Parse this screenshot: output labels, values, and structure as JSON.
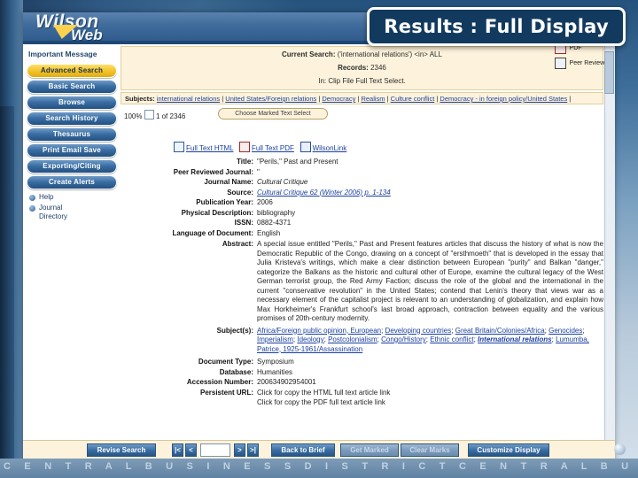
{
  "slide": {
    "overlay_title": "Results : Full Display",
    "footer_band_text": "C E N T R A L   B U S I N E S S   D I S T R I C T   C E N T R A L   B U S I N E S S   D I S T R I C T   C E N T R A"
  },
  "window": {
    "logo_top": "Wilson",
    "logo_bottom": "Web",
    "header_title": "Results: Full Display"
  },
  "sidebar": {
    "message": "Important Message",
    "items": [
      {
        "label": "Advanced Search",
        "selected": true
      },
      {
        "label": "Basic Search",
        "selected": false
      },
      {
        "label": "Browse",
        "selected": false
      },
      {
        "label": "Search History",
        "selected": false
      },
      {
        "label": "Thesaurus",
        "selected": false
      },
      {
        "label": "Print Email Save",
        "selected": false
      },
      {
        "label": "Exporting/Citing",
        "selected": false
      },
      {
        "label": "Create Alerts",
        "selected": false
      }
    ],
    "links": [
      "Help",
      "Journal",
      "Directory"
    ]
  },
  "legend": [
    {
      "icon": "pdf-icon",
      "label": "PDF"
    },
    {
      "icon": "peer-reviewed-icon",
      "label": "Peer Reviewed"
    }
  ],
  "search_summary": {
    "current_search_label": "Current Search:",
    "current_search_value": "('international relations') <in> ALL",
    "records_label": "Records:",
    "records_value": "2346",
    "limits": "In: Clip File Full Text Select."
  },
  "subject_bar": {
    "label": "Subjects:",
    "links": [
      "international relations",
      "United States/Foreign relations",
      "Democracy",
      "Realism",
      "Culture conflict",
      "Democracy - in foreign policy/United States"
    ]
  },
  "toolbar": {
    "zoom": "100%",
    "record_position": "1 of 2346",
    "select_button": "Choose Marked Text Select"
  },
  "record": {
    "links": [
      {
        "icon": "html-doc-icon",
        "label": "Full Text HTML"
      },
      {
        "icon": "pdf-doc-icon",
        "label": "Full Text PDF"
      },
      {
        "icon": "wilsonlink-icon",
        "label": "WilsonLink"
      }
    ],
    "fields": [
      {
        "label": "Title:",
        "value": "\"Perils,\" Past and Present",
        "style": "plain"
      },
      {
        "label": "Peer Reviewed Journal:",
        "value": "\"",
        "style": "plain"
      },
      {
        "label": "Journal Name:",
        "value": "Cultural Critique",
        "style": "italic"
      },
      {
        "label": "Source:",
        "value": "Cultural Critique  62 (Winter 2006) p. 1-134",
        "style": "link-italic"
      },
      {
        "label": "Publication Year:",
        "value": "2006",
        "style": "plain"
      },
      {
        "label": "Physical Description:",
        "value": "bibliography",
        "style": "plain"
      },
      {
        "label": "ISSN:",
        "value": "0882-4371",
        "style": "plain"
      },
      {
        "label": "Language of Document:",
        "value": "English",
        "style": "plain"
      }
    ],
    "abstract_label": "Abstract:",
    "abstract": "A special issue entitled \"Perils,\" Past and Present features articles that discuss the history of what is now the Democratic Republic of the Congo, drawing on a concept of \"ersthmoeth\" that is developed in the essay that Julia Kristeva's writings, which make a clear distinction between European \"purity\" and Balkan \"danger,\" categorize the Balkans as the historic and cultural other of Europe, examine the cultural legacy of the West German terrorist group, the Red Army Faction; discuss the role of the global and the international in the current \"conservative revolution\" in the United States; contend that Lenin's theory that views war as a necessary element of the capitalist project is relevant to an understanding of globalization, and explain how Max Horkheimer's Frankfurt school's last broad approach, contraction between equality and the various promises of 20th-century modernity.",
    "subjects_label": "Subject(s):",
    "subjects": [
      "Africa/Foreign public opinion, European",
      "Developing countries",
      "Great Britain/Colonies/Africa",
      "Genocides",
      "Imperialism",
      "Ideology",
      "Postcolonialism",
      "Congo/History",
      "Ethnic conflict",
      "International relations",
      "Lumumba, Patrice, 1925-1961/Assassination"
    ],
    "tail_fields": [
      {
        "label": "Document Type:",
        "value": "Symposium"
      },
      {
        "label": "Database:",
        "value": "Humanities"
      },
      {
        "label": "Accession Number:",
        "value": "200634902954001"
      },
      {
        "label": "Persistent URL:",
        "value": "Click for copy the HTML full text article link"
      },
      {
        "label": "",
        "value": "Click for copy the PDF full text article link"
      }
    ]
  },
  "footer": {
    "revise_search": "Revise Search",
    "nav_first": "|<",
    "nav_prev": "<",
    "page_value": "",
    "nav_next": ">",
    "nav_last": ">|",
    "back_to_brief": "Back to Brief",
    "get_marked": "Get Marked",
    "clear_marks": "Clear Marks",
    "customize_display": "Customize Display"
  }
}
